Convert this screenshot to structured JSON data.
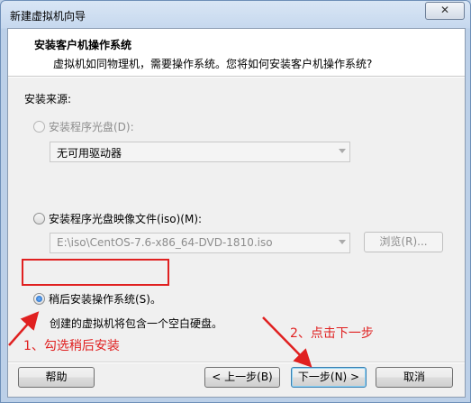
{
  "window": {
    "title": "新建虚拟机向导",
    "close_glyph": "✕"
  },
  "header": {
    "title": "安装客户机操作系统",
    "subtitle": "虚拟机如同物理机，需要操作系统。您将如何安装客户机操作系统?"
  },
  "install_source": {
    "label": "安装来源:",
    "options": [
      {
        "label": "安装程序光盘(D):",
        "selected": false,
        "enabled": false
      },
      {
        "label": "安装程序光盘映像文件(iso)(M):",
        "selected": false,
        "enabled": true
      },
      {
        "label": "稍后安装操作系统(S)。",
        "selected": true,
        "enabled": true
      }
    ],
    "disc_dropdown": {
      "value": "无可用驱动器"
    },
    "iso_dropdown": {
      "value": "E:\\iso\\CentOS-7.6-x86_64-DVD-1810.iso"
    },
    "browse_button": "浏览(R)...",
    "later_description": "创建的虚拟机将包含一个空白硬盘。"
  },
  "buttons": {
    "help": "帮助",
    "back": "< 上一步(B)",
    "next": "下一步(N) >",
    "cancel": "取消"
  },
  "annotations": {
    "step1": "1、勾选稍后安装",
    "step2": "2、点击下一步",
    "color": "#e02020"
  }
}
